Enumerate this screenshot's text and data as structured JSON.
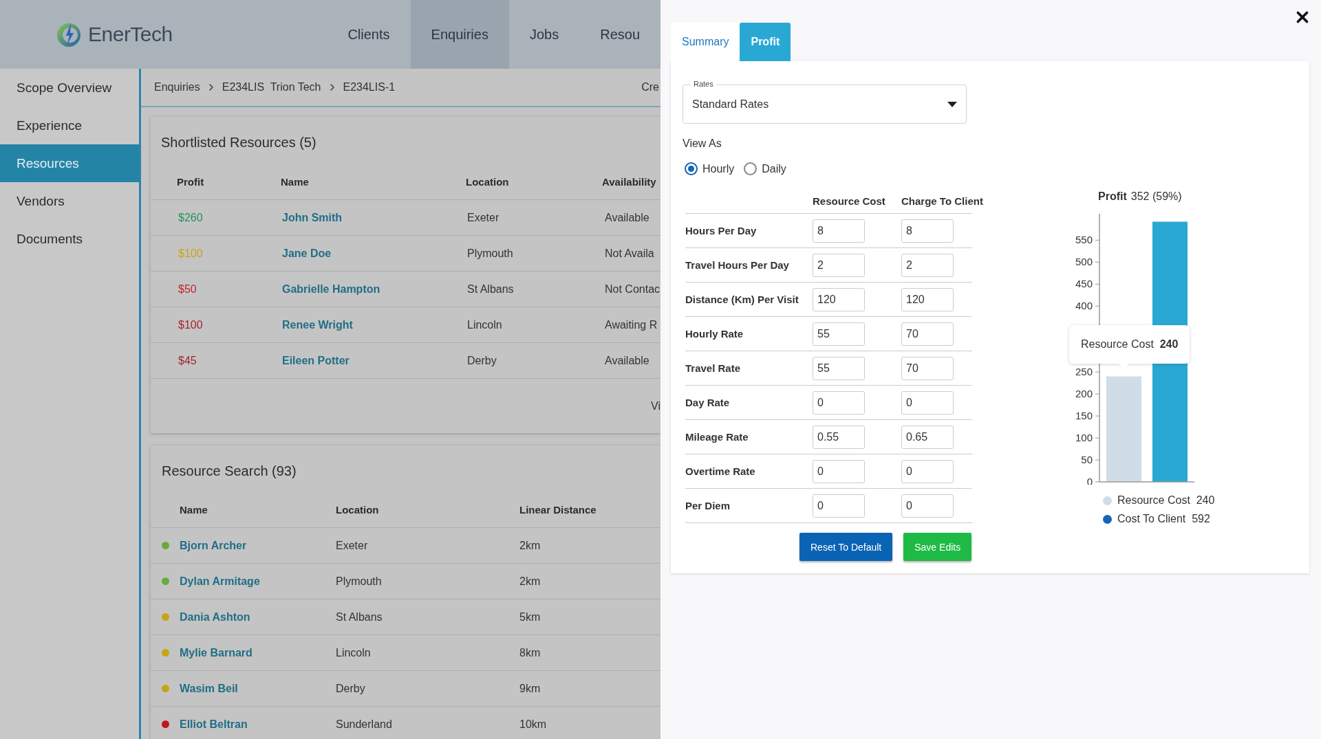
{
  "header": {
    "logo": "EnerTech",
    "nav": [
      {
        "label": "Clients",
        "selected": false
      },
      {
        "label": "Enquiries",
        "selected": true
      },
      {
        "label": "Jobs",
        "selected": false
      },
      {
        "label": "Resou",
        "selected": false
      }
    ]
  },
  "sidebar": {
    "items": [
      {
        "label": "Scope Overview",
        "selected": false
      },
      {
        "label": "Experience",
        "selected": false
      },
      {
        "label": "Resources",
        "selected": true
      },
      {
        "label": "Vendors",
        "selected": false
      },
      {
        "label": "Documents",
        "selected": false
      }
    ]
  },
  "breadcrumb": {
    "items": [
      "Enquiries",
      "E234LIS  Trion Tech",
      "E234LIS-1"
    ],
    "action": "Cre"
  },
  "shortlist": {
    "title": "Shortlisted Resources (5)",
    "columns": [
      "Profit",
      "Name",
      "Location",
      "Availability"
    ],
    "rows": [
      {
        "profit": "$260",
        "color": "#22955a",
        "name": "John Smith",
        "location": "Exeter",
        "availability": "Available"
      },
      {
        "profit": "$100",
        "color": "#c9a412",
        "name": "Jane Doe",
        "location": "Plymouth",
        "availability": "Not Availa"
      },
      {
        "profit": "$50",
        "color": "#c0242a",
        "name": "Gabrielle Hampton",
        "location": "St Albans",
        "availability": "Not Contac"
      },
      {
        "profit": "$100",
        "color": "#a8232a",
        "name": "Renee Wright",
        "location": "Lincoln",
        "availability": "Awaiting R"
      },
      {
        "profit": "$45",
        "color": "#a8232a",
        "name": "Eileen Potter",
        "location": "Derby",
        "availability": "Available"
      }
    ],
    "footer_link": "Vi"
  },
  "search": {
    "title": "Resource Search (93)",
    "columns": [
      "Name",
      "Location",
      "Linear Distance"
    ],
    "rows": [
      {
        "color": "#6aaa3a",
        "name": "Bjorn Archer",
        "location": "Exeter",
        "distance": "2km"
      },
      {
        "color": "#6aaa3a",
        "name": "Dylan Armitage",
        "location": "Plymouth",
        "distance": "2km"
      },
      {
        "color": "#c9a412",
        "name": "Dania Ashton",
        "location": "St Albans",
        "distance": "5km"
      },
      {
        "color": "#c9a412",
        "name": "Mylie Barnard",
        "location": "Lincoln",
        "distance": "8km"
      },
      {
        "color": "#c9a412",
        "name": "Wasim Beil",
        "location": "Derby",
        "distance": "9km"
      },
      {
        "color": "#c3161c",
        "name": "Elliot Beltran",
        "location": "Sunderland",
        "distance": "10km"
      }
    ]
  },
  "drawer": {
    "tabs": [
      {
        "label": "Summary",
        "selected": false
      },
      {
        "label": "Profit",
        "selected": true
      }
    ],
    "rates": {
      "label": "Rates",
      "value": "Standard Rates"
    },
    "view_as": {
      "label": "View As",
      "options": [
        {
          "label": "Hourly",
          "selected": true
        },
        {
          "label": "Daily",
          "selected": false
        }
      ]
    },
    "table": {
      "columns": [
        "Resource Cost",
        "Charge To Client"
      ],
      "rows": [
        {
          "label": "Hours Per Day",
          "resource_cost": "8",
          "charge": "8"
        },
        {
          "label": "Travel Hours Per Day",
          "resource_cost": "2",
          "charge": "2"
        },
        {
          "label": "Distance (Km) Per Visit",
          "resource_cost": "120",
          "charge": "120"
        },
        {
          "label": "Hourly Rate",
          "resource_cost": "55",
          "charge": "70"
        },
        {
          "label": "Travel Rate",
          "resource_cost": "55",
          "charge": "70"
        },
        {
          "label": "Day Rate",
          "resource_cost": "0",
          "charge": "0"
        },
        {
          "label": "Mileage Rate",
          "resource_cost": "0.55",
          "charge": "0.65"
        },
        {
          "label": "Overtime Rate",
          "resource_cost": "0",
          "charge": "0"
        },
        {
          "label": "Per Diem",
          "resource_cost": "0",
          "charge": "0"
        }
      ]
    },
    "buttons": [
      {
        "label": "Reset To Default",
        "kind": "primary"
      },
      {
        "label": "Save Edits",
        "kind": "success"
      }
    ],
    "chart": {
      "title": "Profit",
      "value": "352 (59%)",
      "tooltip": {
        "label": "Resource Cost",
        "value": "240"
      },
      "legend": [
        {
          "value": "240",
          "color": "#d0dce6"
        },
        {
          "value": "592",
          "color": "#1565b8"
        }
      ],
      "chart_data": {
        "type": "bar",
        "series": [
          {
            "name": "Resource Cost",
            "color": "#d0dce6",
            "values": [
              240
            ]
          },
          {
            "name": "Cost To Client",
            "color": "#2aa8d4",
            "values": [
              592
            ]
          }
        ],
        "ylim": [
          0,
          610
        ],
        "yticks": [
          0,
          50,
          100,
          150,
          200,
          250,
          400,
          450,
          500,
          550
        ]
      }
    }
  }
}
